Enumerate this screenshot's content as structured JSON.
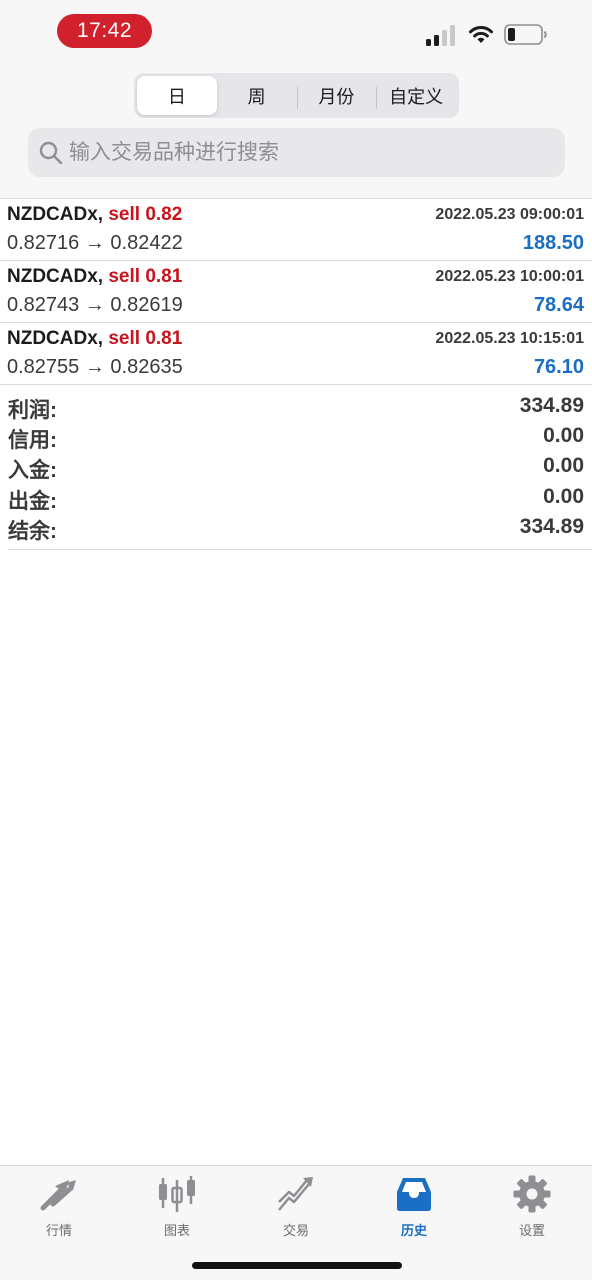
{
  "status_bar": {
    "time": "17:42"
  },
  "segmented": {
    "items": [
      {
        "label": "日",
        "active": true
      },
      {
        "label": "周",
        "active": false
      },
      {
        "label": "月份",
        "active": false
      },
      {
        "label": "自定义",
        "active": false
      }
    ]
  },
  "search": {
    "placeholder": "输入交易品种进行搜索"
  },
  "trades": [
    {
      "symbol": "NZDCADx,",
      "trade": "sell 0.82",
      "datetime": "2022.05.23 09:00:01",
      "prices": "0.82716 → 0.82422",
      "profit": "188.50"
    },
    {
      "symbol": "NZDCADx,",
      "trade": "sell 0.81",
      "datetime": "2022.05.23 10:00:01",
      "prices": "0.82743 → 0.82619",
      "profit": "78.64"
    },
    {
      "symbol": "NZDCADx,",
      "trade": "sell 0.81",
      "datetime": "2022.05.23 10:15:01",
      "prices": "0.82755 → 0.82635",
      "profit": "76.10"
    }
  ],
  "summary": [
    {
      "label": "利润:",
      "value": "334.89"
    },
    {
      "label": "信用:",
      "value": "0.00"
    },
    {
      "label": "入金:",
      "value": "0.00"
    },
    {
      "label": "出金:",
      "value": "0.00"
    },
    {
      "label": "结余:",
      "value": "334.89"
    }
  ],
  "tabbar": {
    "items": [
      {
        "label": "行情",
        "icon": "quotes-arrows-icon",
        "active": false
      },
      {
        "label": "图表",
        "icon": "candlestick-chart-icon",
        "active": false
      },
      {
        "label": "交易",
        "icon": "trade-trend-icon",
        "active": false
      },
      {
        "label": "历史",
        "icon": "history-inbox-icon",
        "active": true
      },
      {
        "label": "设置",
        "icon": "settings-gear-icon",
        "active": false
      }
    ]
  },
  "colors": {
    "accent": "#1a6fc4",
    "sell": "#c8151d",
    "status_pill": "#d0212c"
  }
}
